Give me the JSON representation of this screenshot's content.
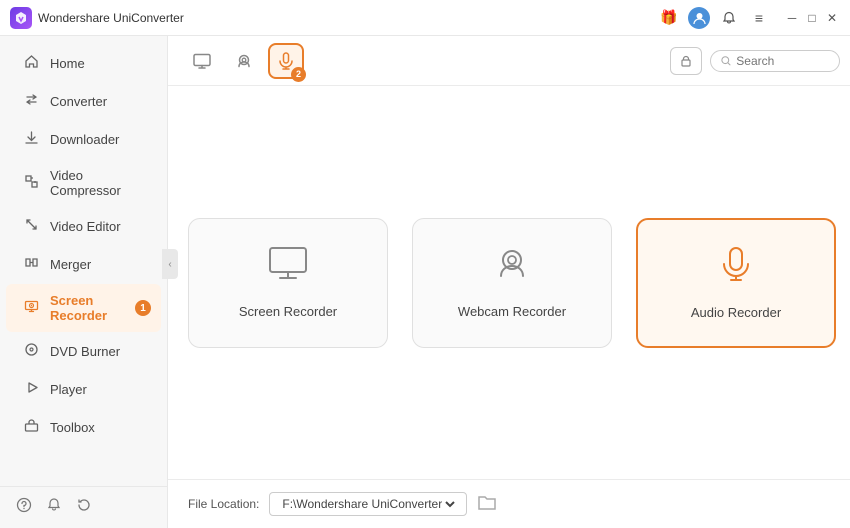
{
  "titleBar": {
    "appName": "Wondershare UniConverter",
    "logoText": "W"
  },
  "titleBarIcons": {
    "gift": "🎁",
    "minimize": "─",
    "maximize": "□",
    "close": "✕"
  },
  "sidebar": {
    "items": [
      {
        "id": "home",
        "label": "Home",
        "icon": "🏠",
        "active": false
      },
      {
        "id": "converter",
        "label": "Converter",
        "icon": "⇄",
        "active": false
      },
      {
        "id": "downloader",
        "label": "Downloader",
        "icon": "↓",
        "active": false
      },
      {
        "id": "video-compressor",
        "label": "Video Compressor",
        "icon": "▣",
        "active": false
      },
      {
        "id": "video-editor",
        "label": "Video Editor",
        "icon": "✂",
        "active": false
      },
      {
        "id": "merger",
        "label": "Merger",
        "icon": "⊞",
        "active": false
      },
      {
        "id": "screen-recorder",
        "label": "Screen Recorder",
        "icon": "⏺",
        "active": true,
        "badge": "1"
      },
      {
        "id": "dvd-burner",
        "label": "DVD Burner",
        "icon": "⊙",
        "active": false
      },
      {
        "id": "player",
        "label": "Player",
        "icon": "▶",
        "active": false
      },
      {
        "id": "toolbox",
        "label": "Toolbox",
        "icon": "⚙",
        "active": false
      }
    ],
    "bottomIcons": [
      "?",
      "🔔",
      "↺"
    ]
  },
  "toolbar": {
    "tabs": [
      {
        "id": "screen",
        "icon": "⬜",
        "active": false
      },
      {
        "id": "webcam",
        "icon": "◉",
        "active": false
      },
      {
        "id": "audio",
        "icon": "🎙",
        "active": true,
        "badge": "2"
      }
    ],
    "searchPlaceholder": "Search"
  },
  "recorderCards": [
    {
      "id": "screen-recorder",
      "label": "Screen Recorder",
      "icon": "🖥",
      "active": false
    },
    {
      "id": "webcam-recorder",
      "label": "Webcam Recorder",
      "icon": "📷",
      "active": false
    },
    {
      "id": "audio-recorder",
      "label": "Audio Recorder",
      "icon": "🎙",
      "active": true
    }
  ],
  "fileLocation": {
    "label": "File Location:",
    "path": "F:\\Wondershare UniConverter"
  },
  "colors": {
    "accent": "#e87d2a",
    "accentBg": "#fff3e8"
  }
}
